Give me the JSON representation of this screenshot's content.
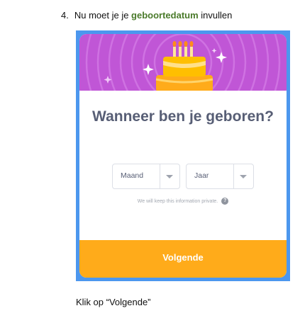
{
  "instruction": {
    "number": "4.",
    "prefix": "Nu moet je je ",
    "highlight": "geboortedatum",
    "suffix": " invullen"
  },
  "dialog": {
    "question": "Wanneer ben je geboren?",
    "month_select": {
      "selected": "Maand",
      "icon": "chevron-down-icon"
    },
    "year_select": {
      "selected": "Jaar",
      "icon": "chevron-down-icon"
    },
    "privacy_note": "We will keep this information private.",
    "help_glyph": "?",
    "next_button": "Volgende",
    "banner_icon": "birthday-cake-icon"
  },
  "caption": "Klik op “Volgende”",
  "colors": {
    "highlight": "#4a7a2a",
    "frame": "#4c97ee",
    "banner": "#c056d6",
    "question_text": "#575e75",
    "button": "#ffab1a",
    "cake": "#ffbf00"
  }
}
